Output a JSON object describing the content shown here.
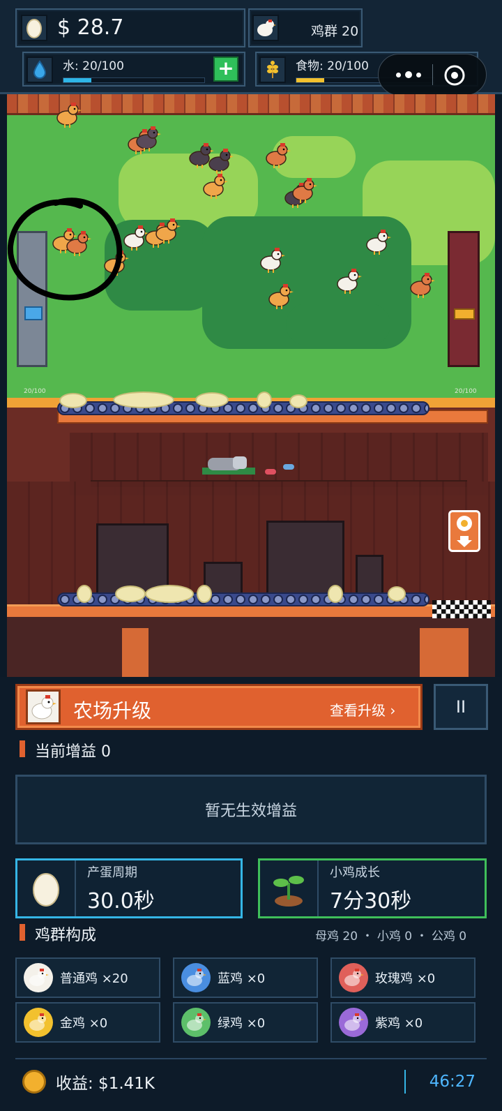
{
  "hud": {
    "money": "$ 28.7",
    "flock": "鸡群 20",
    "water": {
      "label": "水: 20/100",
      "value": 20,
      "max": 100,
      "color": "#2eb6e8",
      "add_label": "+"
    },
    "food": {
      "label": "食物: 20/100",
      "value": 20,
      "max": 100,
      "color": "#f2c12e"
    },
    "capsule_icons": [
      "more-icon",
      "close-target-icon"
    ]
  },
  "scene": {
    "left_tank_text": "20/100",
    "right_tank_text": "20/100",
    "chicken_count_visible": 20
  },
  "upgrade": {
    "title": "农场升级",
    "view_label": "查看升级 ›",
    "pause_label": "II"
  },
  "buffs": {
    "title": "当前增益 0",
    "empty_text": "暂无生效增益"
  },
  "stats": {
    "egg_cycle": {
      "label": "产蛋周期",
      "value": "30.0秒",
      "border": "#35b6e6"
    },
    "chick_growth": {
      "label": "小鸡成长",
      "value": "7分30秒",
      "border": "#3fbf5a"
    }
  },
  "flock": {
    "title": "鸡群构成",
    "summary": "母鸡 20 ・ 小鸡 0 ・ 公鸡 0",
    "breeds": [
      {
        "name": "普通鸡 ×20",
        "color": "#f4f1ea"
      },
      {
        "name": "蓝鸡 ×0",
        "color": "#4a8ee0"
      },
      {
        "name": "玫瑰鸡 ×0",
        "color": "#e0605a"
      },
      {
        "name": "金鸡 ×0",
        "color": "#f2c12e"
      },
      {
        "name": "绿鸡 ×0",
        "color": "#5dbf6a"
      },
      {
        "name": "紫鸡 ×0",
        "color": "#9a6ad8"
      }
    ]
  },
  "footer": {
    "income": "收益: $1.41K",
    "timer": "46:27"
  }
}
